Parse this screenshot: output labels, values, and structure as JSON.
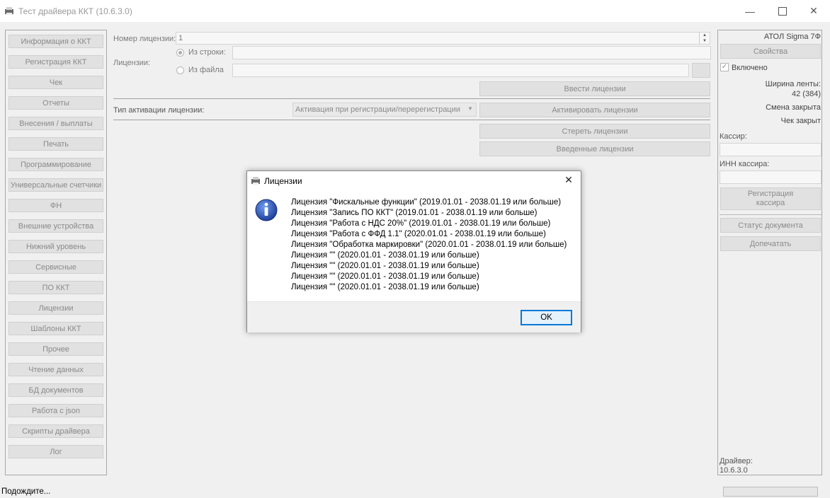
{
  "window": {
    "title": "Тест драйвера ККТ (10.6.3.0)"
  },
  "nav": {
    "items": [
      "Информация о ККТ",
      "Регистрация ККТ",
      "Чек",
      "Отчеты",
      "Внесения / выплаты",
      "Печать",
      "Программирование",
      "Универсальные счетчики",
      "ФН",
      "Внешние устройства",
      "Нижний уровень",
      "Сервисные",
      "ПО ККТ",
      "Лицензии",
      "Шаблоны ККТ",
      "Прочее",
      "Чтение данных",
      "БД документов",
      "Работа с json",
      "Скрипты драйвера",
      "Лог"
    ]
  },
  "license_form": {
    "number_label": "Номер лицензии:",
    "number_value": "1",
    "licenses_label": "Лицензии:",
    "from_string_label": "Из строки:",
    "from_file_label": "Из файла",
    "enter_button": "Ввести лицензии",
    "activation_type_label": "Тип активации лицензии:",
    "activation_type_value": "Активация при регистрации/перерегистрации",
    "activate_button": "Активировать лицензии",
    "erase_button": "Стереть лицензии",
    "entered_button": "Введенные лицензии"
  },
  "right_panel": {
    "device_name": "АТОЛ Sigma 7Ф",
    "properties_button": "Свойства",
    "enabled_label": "Включено",
    "tape_width_label": "Ширина ленты:",
    "tape_width_value": "42 (384)",
    "shift_status": "Смена закрыта",
    "receipt_status": "Чек закрыт",
    "cashier_label": "Кассир:",
    "cashier_inn_label": "ИНН кассира:",
    "register_cashier_line1": "Регистрация",
    "register_cashier_line2": "кассира",
    "doc_status_button": "Статус документа",
    "reprint_button": "Допечатать",
    "driver_label": "Драйвер:",
    "driver_version": "10.6.3.0"
  },
  "dialog": {
    "title": "Лицензии",
    "lines": [
      "Лицензия \"Фискальные функции\" (2019.01.01 - 2038.01.19 или больше)",
      "Лицензия \"Запись ПО ККТ\" (2019.01.01 - 2038.01.19 или больше)",
      "Лицензия \"Работа с НДС 20%\" (2019.01.01 - 2038.01.19 или больше)",
      "Лицензия \"Работа с ФФД 1.1\" (2020.01.01 - 2038.01.19 или больше)",
      "Лицензия \"Обработка маркировки\" (2020.01.01 - 2038.01.19 или больше)",
      "Лицензия \"\" (2020.01.01 - 2038.01.19 или больше)",
      "Лицензия \"\" (2020.01.01 - 2038.01.19 или больше)",
      "Лицензия \"\" (2020.01.01 - 2038.01.19 или больше)",
      "Лицензия \"\" (2020.01.01 - 2038.01.19 или больше)"
    ],
    "ok_label": "OK"
  },
  "status": {
    "text": "Подождите..."
  },
  "colors": {
    "accent": "#0078d7",
    "info_icon": "#1f4fb5"
  }
}
